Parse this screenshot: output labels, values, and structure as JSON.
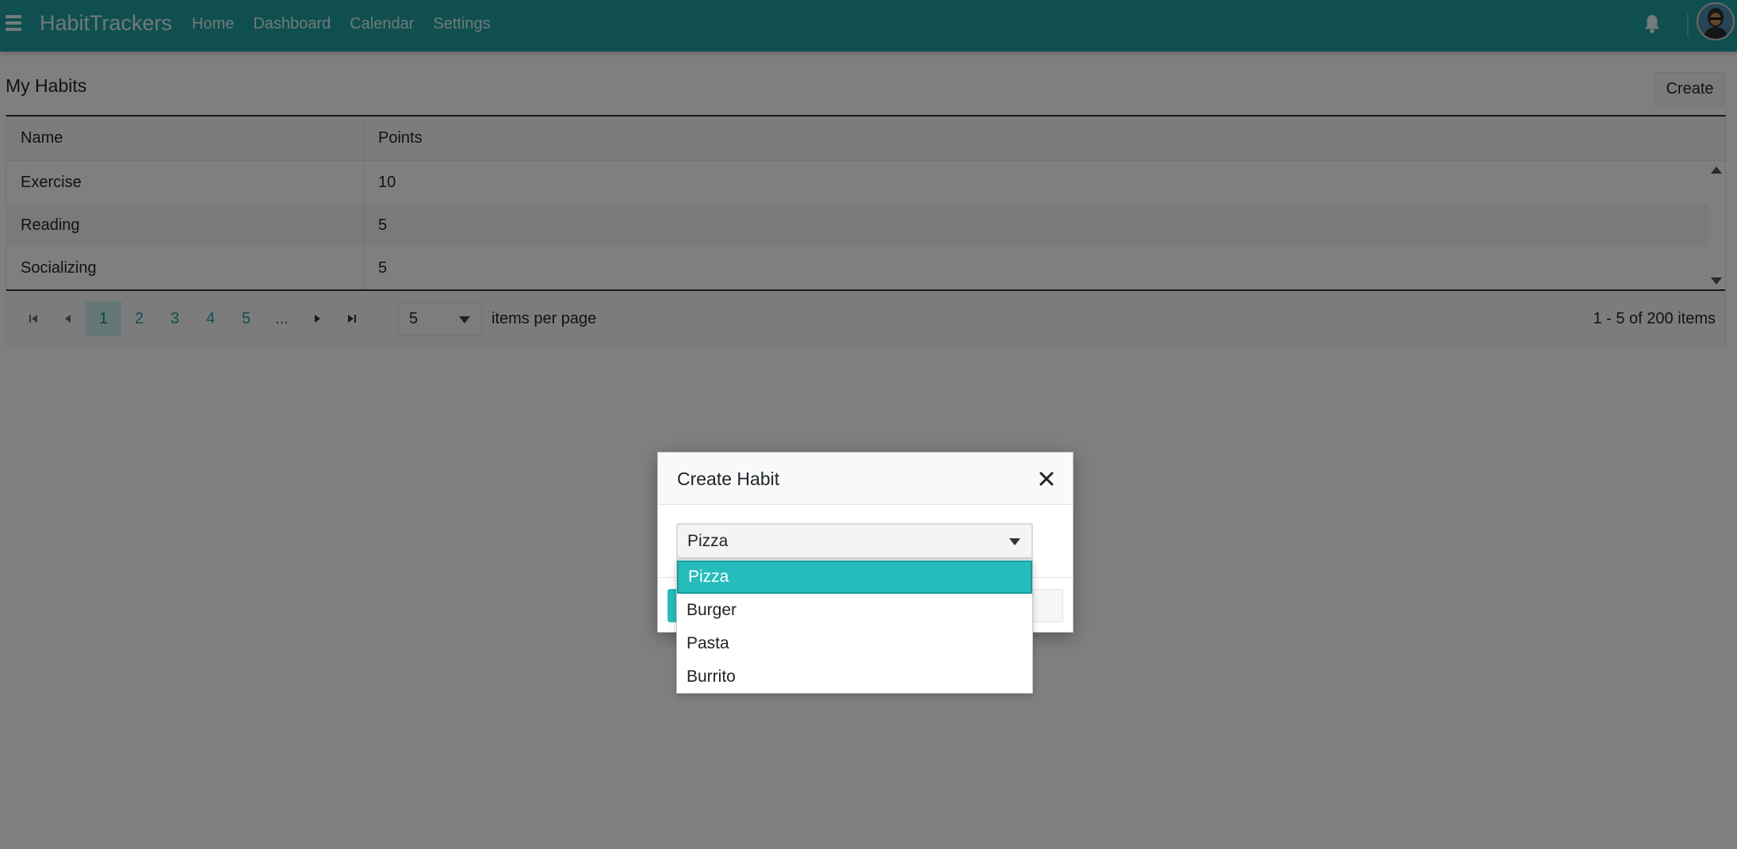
{
  "navbar": {
    "brand": "HabitTrackers",
    "links": [
      "Home",
      "Dashboard",
      "Calendar",
      "Settings"
    ],
    "bg_color": "#209e9e",
    "icons": [
      "menu-icon",
      "bell-icon",
      "user-avatar"
    ]
  },
  "grid": {
    "title": "My Habits",
    "create_label": "Create",
    "columns": [
      "Name",
      "Points"
    ],
    "rows": [
      {
        "name": "Exercise",
        "points": "10"
      },
      {
        "name": "Reading",
        "points": "5"
      },
      {
        "name": "Socializing",
        "points": "5"
      }
    ],
    "pager": {
      "pages": [
        "1",
        "2",
        "3",
        "4",
        "5",
        "..."
      ],
      "current_page": "1",
      "page_size": "5",
      "items_label": "items per page",
      "info": "1 - 5 of 200 items"
    }
  },
  "dialog": {
    "title": "Create Habit",
    "select": {
      "value": "Pizza",
      "options": [
        "Pizza",
        "Burger",
        "Pasta",
        "Burrito"
      ],
      "selected_index": 0
    }
  },
  "colors": {
    "accent": "#27bcbc",
    "pager_active_bg": "#c9eeee"
  }
}
